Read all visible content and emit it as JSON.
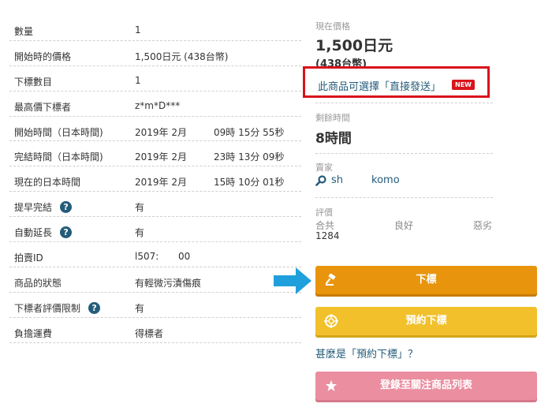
{
  "details": {
    "rows": [
      {
        "label": "數量",
        "value": "1"
      },
      {
        "label": "開始時的價格",
        "value": "1,500日元 (438台幣)"
      },
      {
        "label": "下標數目",
        "value": "1"
      },
      {
        "label": "最高價下標者",
        "value": "z*m*D***"
      },
      {
        "label": "開始時間（日本時間)",
        "value": "2019年 2月",
        "value2": "09時 15分 55秒"
      },
      {
        "label": "完結時間（日本時間)",
        "value": "2019年 2月",
        "value2": "23時 13分 09秒"
      },
      {
        "label": "現在的日本時間",
        "value": "2019年 2月",
        "value2": "15時 10分 01秒"
      },
      {
        "label": "提早完結",
        "value": "有",
        "help": "?"
      },
      {
        "label": "自動延長",
        "value": "有",
        "help": "?"
      },
      {
        "label": "拍賣ID",
        "value": "l507:",
        "value2": "00"
      },
      {
        "label": "商品的狀態",
        "value": "有輕微污漬傷痕"
      },
      {
        "label": "下標者評價限制",
        "value": "有",
        "help": "?"
      },
      {
        "label": "負擔運費",
        "value": "得標者"
      }
    ]
  },
  "panel": {
    "current_price_label": "現在價格",
    "price": "1,500日元",
    "price_twd": "(438台幣)",
    "direct_ship_text": "此商品可選擇「直接發送」",
    "new_badge": "NEW",
    "time_left_label": "剩餘時間",
    "time_left": "8時間",
    "seller_label": "賣家",
    "seller_name_part1": "sh",
    "seller_name_part2": "komo",
    "rating_label": "評價",
    "rating_total_label": "合共",
    "rating_good_label": "良好",
    "rating_bad_label": "惡劣",
    "rating_total": "1284",
    "bid_button": "下標",
    "reserve_button": "預約下標",
    "what_is_reserve": "甚麼是「預約下標」？",
    "watch_button": "登錄至關注商品列表"
  },
  "colors": {
    "bid": "#e8950d",
    "reserve": "#f1c02b",
    "watch": "#ea8ea0",
    "link": "#245c7a",
    "highlight": "#d9131b",
    "arrow": "#1fa0dc"
  },
  "icons": [
    "gavel-icon",
    "target-icon",
    "star-icon",
    "search-icon",
    "help-icon",
    "arrow-right-icon"
  ]
}
